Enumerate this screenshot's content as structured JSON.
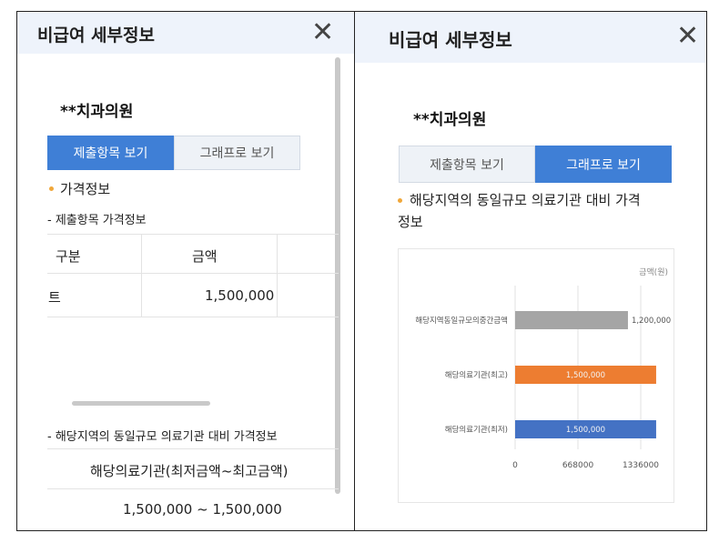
{
  "left_panel": {
    "title": "비급여 세부정보",
    "close_glyph": "✕",
    "clinic_name": "**치과의원",
    "tabs": [
      {
        "label": "제출항목 보기",
        "active": true
      },
      {
        "label": "그래프로 보기",
        "active": false
      }
    ],
    "section_price": "가격정보",
    "subsection_items": "- 제출항목 가격정보",
    "table": {
      "headers": [
        "구분",
        "금액"
      ],
      "rows": [
        {
          "item": "트",
          "amount": "1,500,000"
        }
      ]
    },
    "subsection_compare": "- 해당지역의 동일규모 의료기관 대비 가격정보",
    "compare_header": "해당의료기관(최저금액~최고금액)",
    "compare_value": "1,500,000 ~ 1,500,000"
  },
  "right_panel": {
    "title": "비급여 세부정보",
    "close_glyph": "✕",
    "clinic_name": "**치과의원",
    "tabs": [
      {
        "label": "제출항목 보기",
        "active": false
      },
      {
        "label": "그래프로 보기",
        "active": true
      }
    ],
    "section_title_line1": "해당지역의 동일규모 의료기관 대비 가격",
    "section_title_line2": "정보"
  },
  "chart_data": {
    "type": "bar",
    "orientation": "horizontal",
    "unit_label": "금액(원)",
    "categories": [
      "해당지역동일규모의중간금액",
      "해당의료기관(최고)",
      "해당의료기관(최저)"
    ],
    "values": [
      1200000,
      1500000,
      1500000
    ],
    "value_labels": [
      "1,200,000",
      "1,500,000",
      "1,500,000"
    ],
    "colors": [
      "#a5a5a5",
      "#ed7d31",
      "#4472c4"
    ],
    "x_ticks": [
      0,
      668000,
      1336000
    ],
    "x_tick_labels": [
      "0",
      "668000",
      "1336000"
    ],
    "xlim": [
      0,
      1336000
    ],
    "grid": true,
    "legend": "none"
  }
}
